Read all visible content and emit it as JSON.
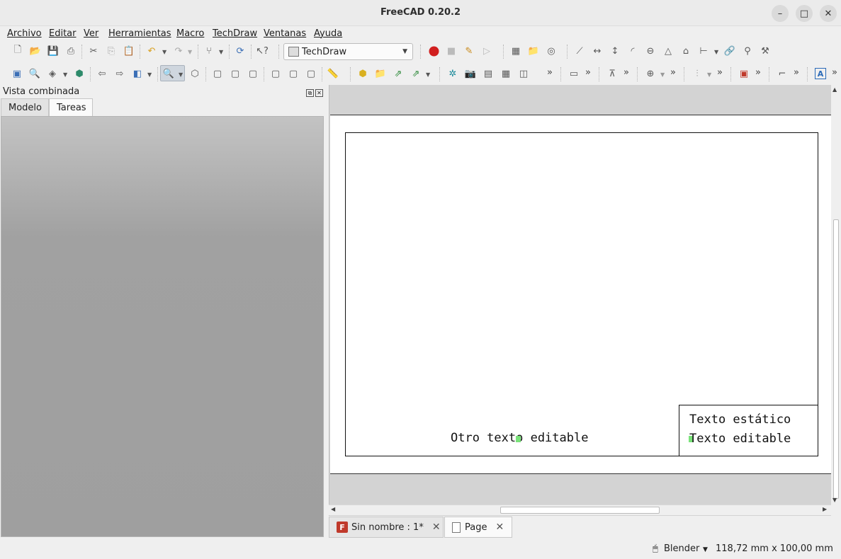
{
  "window": {
    "title": "FreeCAD 0.20.2"
  },
  "menu": [
    "Archivo",
    "Editar",
    "Ver",
    "Herramientas",
    "Macro",
    "TechDraw",
    "Ventanas",
    "Ayuda"
  ],
  "toolbar": {
    "workbench": "TechDraw",
    "overflow": "»"
  },
  "combo": {
    "title": "Vista combinada",
    "tabs": [
      "Modelo",
      "Tareas"
    ],
    "active_tab": "Tareas"
  },
  "drawing": {
    "title_block_static": "Texto estático",
    "title_block_editable": "Texto editable",
    "other_editable": "Otro texto editable"
  },
  "documents": [
    {
      "label": "Sin nombre : 1*",
      "icon": "freecad-document-icon",
      "active": false
    },
    {
      "label": "Page",
      "icon": "page-icon",
      "active": true
    }
  ],
  "status": {
    "navigation": "Blender",
    "dimensions": "118,72 mm x 100,00 mm"
  },
  "colors": {
    "record": "#d11f1f",
    "marker": "#7ae27a",
    "panel": "#a3a3a3"
  }
}
